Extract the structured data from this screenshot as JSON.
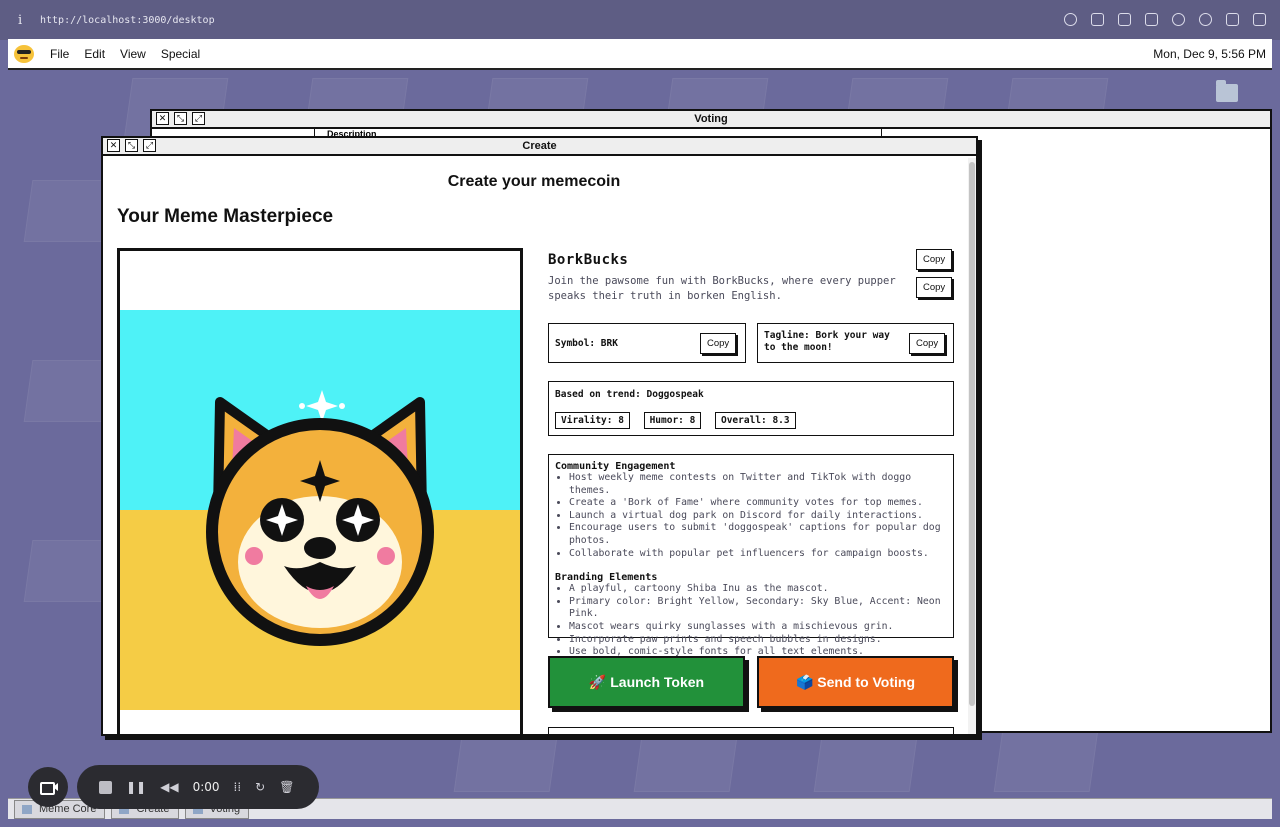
{
  "browser": {
    "info_glyph": "i",
    "url": "http://localhost:3000/desktop"
  },
  "menubar": {
    "items": [
      "File",
      "Edit",
      "View",
      "Special"
    ],
    "clock": "Mon, Dec 9, 5:56 PM"
  },
  "voting_window": {
    "title": "Voting",
    "column_header": "Description"
  },
  "create_window": {
    "title": "Create",
    "header": "Create your memecoin",
    "subheader": "Your Meme Masterpiece",
    "coin": {
      "name": "BorkBucks",
      "description": "Join the pawsome fun with BorkBucks, where every pupper speaks their truth in borken English.",
      "symbol": "Symbol: BRK",
      "tagline": "Tagline: Bork your way to the moon!"
    },
    "copy_label": "Copy",
    "trend": {
      "label": "Based on trend: Doggospeak",
      "virality": "Virality: 8",
      "humor": "Humor: 8",
      "overall": "Overall: 8.3"
    },
    "community": {
      "title": "Community Engagement",
      "items": [
        "Host weekly meme contests on Twitter and TikTok with doggo themes.",
        "Create a 'Bork of Fame' where community votes for top memes.",
        "Launch a virtual dog park on Discord for daily interactions.",
        "Encourage users to submit 'doggospeak' captions for popular dog photos.",
        "Collaborate with popular pet influencers for campaign boosts."
      ]
    },
    "branding": {
      "title": "Branding Elements",
      "items": [
        "A playful, cartoony Shiba Inu as the mascot.",
        "Primary color: Bright Yellow, Secondary: Sky Blue, Accent: Neon Pink.",
        "Mascot wears quirky sunglasses with a mischievous grin.",
        "Incorporate paw prints and speech bubbles in designs.",
        "Use bold, comic-style fonts for all text elements."
      ]
    },
    "launch_button": "🚀 Launch Token",
    "voting_button": "🗳️ Send to Voting"
  },
  "recorder": {
    "time": "0:00"
  },
  "taskbar": {
    "items": [
      "Meme Core",
      "Create",
      "Voting"
    ]
  },
  "colors": {
    "desktop": "#6b6a9c",
    "launch": "#22913a",
    "voting": "#ef6a1d",
    "sky": "#4ef2f7",
    "sand": "#f5cc45"
  }
}
